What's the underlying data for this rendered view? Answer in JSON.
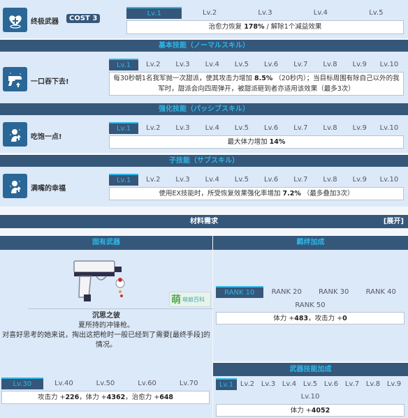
{
  "ultimate_weapon": {
    "icon": "heart-heal-icon",
    "label": "终极武器",
    "cost_label": "COST 3",
    "tabs": [
      "Lv.1",
      "Lv.2",
      "Lv.3",
      "Lv.4",
      "Lv.5"
    ],
    "active_tab": 0,
    "desc_prefix": "治愈力恢复 ",
    "desc_bold": "178%",
    "desc_suffix": " / 解除1个减益效果"
  },
  "basic_skill": {
    "header": "基本技能（ノーマルスキル）",
    "icon": "pistol-icon",
    "name": "一口吞下去!",
    "tabs": [
      "Lv.1",
      "Lv.2",
      "Lv.3",
      "Lv.4",
      "Lv.5",
      "Lv.6",
      "Lv.7",
      "Lv.8",
      "Lv.9",
      "Lv.10"
    ],
    "active_tab": 0,
    "desc_prefix": "每30秒朝1名我军抛一次甜派，使其攻击力增加 ",
    "desc_bold": "8.5%",
    "desc_suffix": " （20秒内）；当目标周围有除自己以外的我军时，甜派会向四周弹开，被甜派砸到者亦适用该效果（最多3次）"
  },
  "enhanced_skill": {
    "header": "强化技能（パッシブスキル）",
    "icon": "character-buff-icon",
    "name": "吃饱一点!",
    "tabs": [
      "Lv.1",
      "Lv.2",
      "Lv.3",
      "Lv.4",
      "Lv.5",
      "Lv.6",
      "Lv.7",
      "Lv.8",
      "Lv.9",
      "Lv.10"
    ],
    "active_tab": 0,
    "desc_prefix": "最大体力增加 ",
    "desc_bold": "14%",
    "desc_suffix": ""
  },
  "sub_skill": {
    "header": "子技能（サブスキル）",
    "icon": "character-buff-icon",
    "name": "满嘴的幸福",
    "tabs": [
      "Lv.1",
      "Lv.2",
      "Lv.3",
      "Lv.4",
      "Lv.5",
      "Lv.6",
      "Lv.7",
      "Lv.8",
      "Lv.9",
      "Lv.10"
    ],
    "active_tab": 0,
    "desc_prefix": "使用EX技能时，所受恢复效果强化率增加 ",
    "desc_bold": "7.2%",
    "desc_suffix": " （最多叠加3次）"
  },
  "materials": {
    "header": "材料需求",
    "expand_label": "[展开]"
  },
  "unique_weapon": {
    "header": "固有武器",
    "weapon_name": "沉思之彼",
    "line1": "夏所持的冲锋枪。",
    "line2": "对喜好思考的她来说，掏出这把枪时一般已经到了需要[最终手段]的情况。",
    "watermark_char": "萌",
    "watermark_text": "萌娘百科",
    "tabs": [
      "Lv.30",
      "Lv.40",
      "Lv.50",
      "Lv.60",
      "Lv.70"
    ],
    "active_tab": 0,
    "stats": [
      {
        "label": "攻击力 +",
        "value": "226"
      },
      {
        "label": "，体力 +",
        "value": "4362"
      },
      {
        "label": "，治愈力 +",
        "value": "648"
      }
    ]
  },
  "bond_bonus": {
    "header": "羁绊加成",
    "tabs_row1": [
      "RANK 10",
      "RANK 20",
      "RANK 30",
      "RANK 40"
    ],
    "tabs_row2": [
      "RANK 50"
    ],
    "active_tab": 0,
    "stats": [
      {
        "label": "体力 +",
        "value": "483"
      },
      {
        "label": "，攻击力 +",
        "value": "0"
      }
    ]
  },
  "weapon_skill_bonus": {
    "header": "武器技能加成",
    "tabs_row1": [
      "Lv.1",
      "Lv.2",
      "Lv.3",
      "Lv.4",
      "Lv.5",
      "Lv.6",
      "Lv.7",
      "Lv.8",
      "Lv.9"
    ],
    "tabs_row2": [
      "Lv.10"
    ],
    "active_tab": 0,
    "stats": [
      {
        "label": "体力 +",
        "value": "4052"
      }
    ]
  }
}
